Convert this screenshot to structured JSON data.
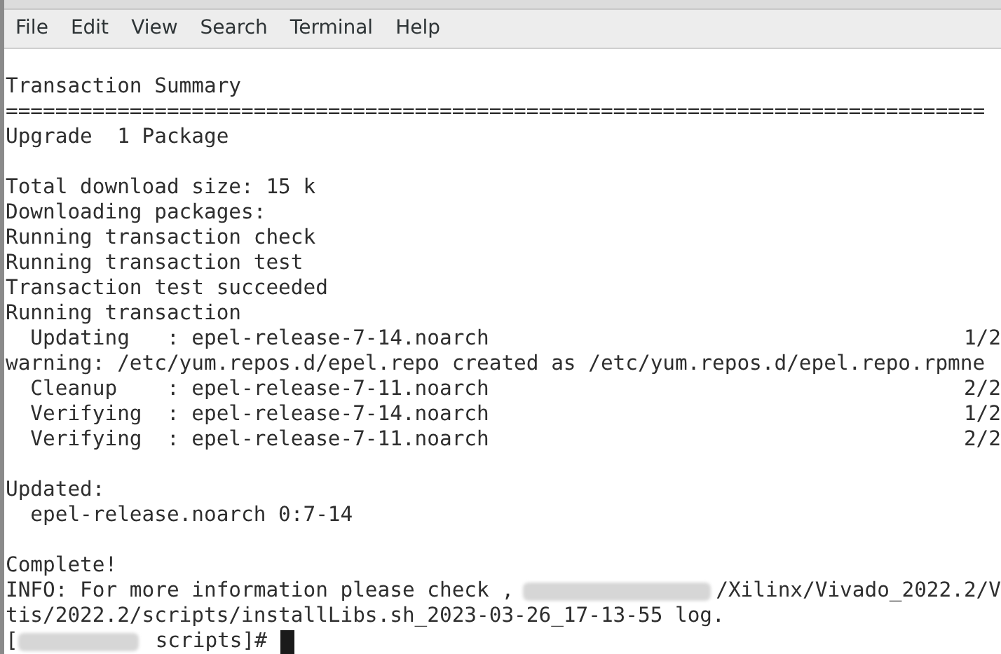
{
  "menu": [
    "File",
    "Edit",
    "View",
    "Search",
    "Terminal",
    "Help"
  ],
  "lines": [
    {
      "kind": "blank"
    },
    {
      "kind": "text",
      "text": "Transaction Summary"
    },
    {
      "kind": "text",
      "text": "==============================================================================="
    },
    {
      "kind": "text",
      "text": "Upgrade  1 Package"
    },
    {
      "kind": "blank"
    },
    {
      "kind": "text",
      "text": "Total download size: 15 k"
    },
    {
      "kind": "text",
      "text": "Downloading packages:"
    },
    {
      "kind": "text",
      "text": "Running transaction check"
    },
    {
      "kind": "text",
      "text": "Running transaction test"
    },
    {
      "kind": "text",
      "text": "Transaction test succeeded"
    },
    {
      "kind": "text",
      "text": "Running transaction"
    },
    {
      "kind": "step",
      "text": "  Updating   : epel-release-7-14.noarch",
      "progress": "1/2"
    },
    {
      "kind": "text",
      "text": "warning: /etc/yum.repos.d/epel.repo created as /etc/yum.repos.d/epel.repo.rpmne"
    },
    {
      "kind": "step",
      "text": "  Cleanup    : epel-release-7-11.noarch",
      "progress": "2/2"
    },
    {
      "kind": "step",
      "text": "  Verifying  : epel-release-7-14.noarch",
      "progress": "1/2"
    },
    {
      "kind": "step",
      "text": "  Verifying  : epel-release-7-11.noarch",
      "progress": "2/2"
    },
    {
      "kind": "blank"
    },
    {
      "kind": "text",
      "text": "Updated:"
    },
    {
      "kind": "text",
      "text": "  epel-release.noarch 0:7-14"
    },
    {
      "kind": "blank"
    },
    {
      "kind": "text",
      "text": "Complete!"
    },
    {
      "kind": "redacted",
      "before": "INFO: For more information please check ,",
      "after": "/Xilinx/Vivado_2022.2/V"
    },
    {
      "kind": "text",
      "text": "tis/2022.2/scripts/installLibs.sh_2023-03-26_17-13-55 log."
    },
    {
      "kind": "prompt",
      "before": "[",
      "after": "scripts]#"
    }
  ]
}
